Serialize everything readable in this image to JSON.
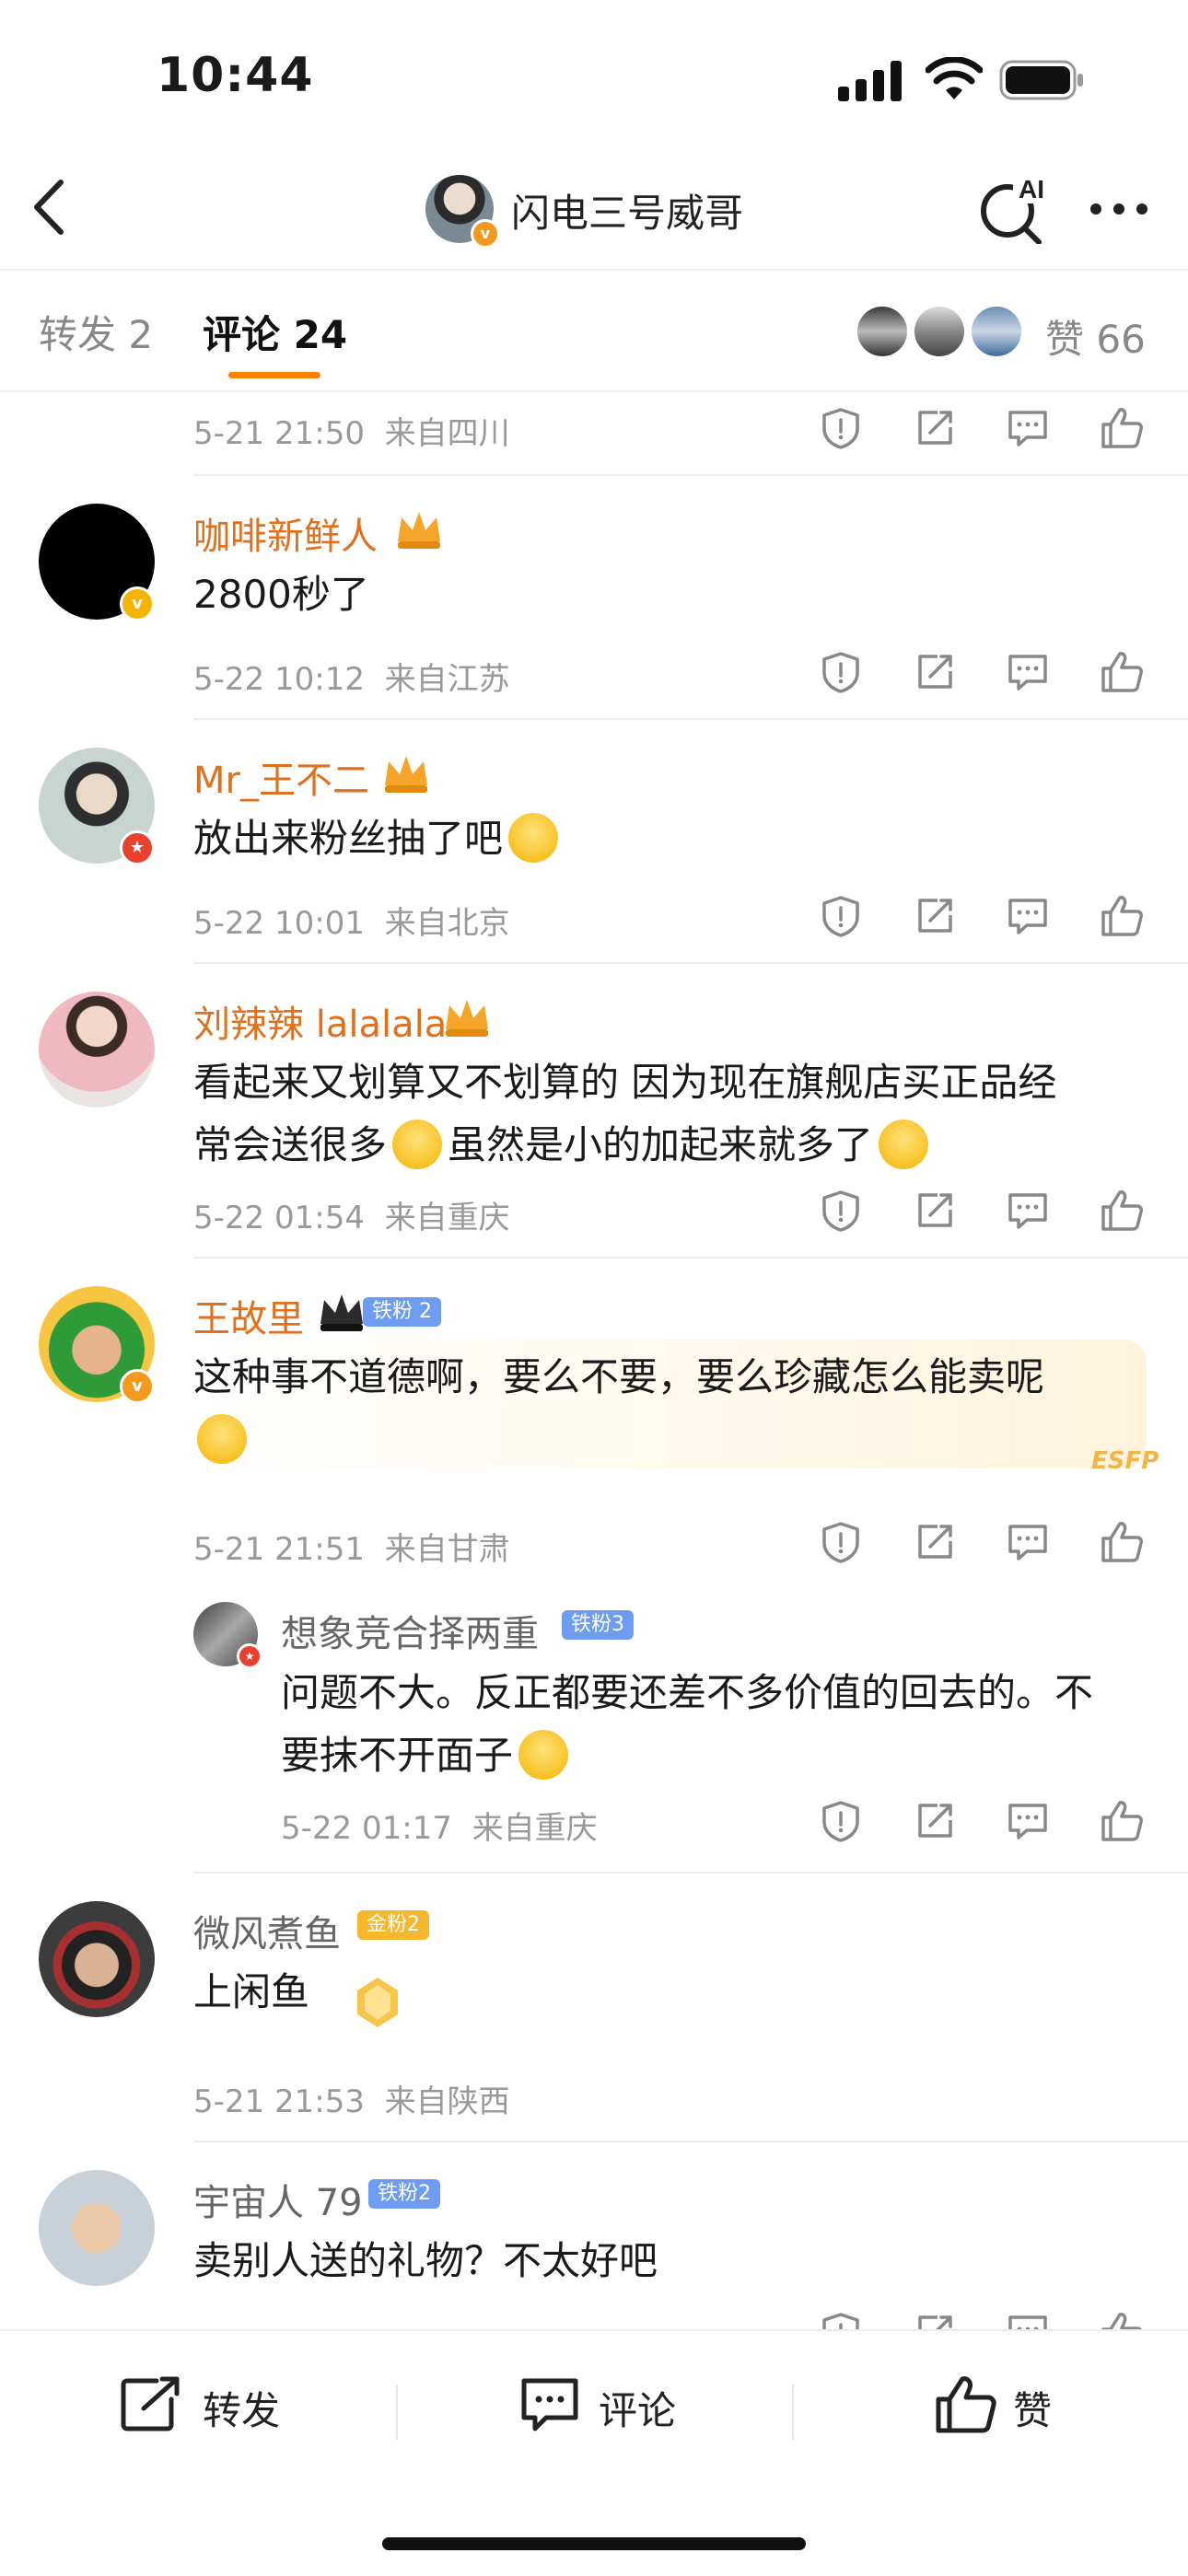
{
  "status_bar": {
    "time": "10:44"
  },
  "nav": {
    "title": "闪电三号威哥",
    "ai_label": "AI"
  },
  "tabs": {
    "repost": "转发 2",
    "comment": "评论 24",
    "likes": "赞 66"
  },
  "top_meta": {
    "date": "5-21 21:50",
    "location": "来自四川"
  },
  "comments": [
    {
      "name": "咖啡新鲜人",
      "text": "2800秒了",
      "date": "5-22 10:12",
      "location": "来自江苏"
    },
    {
      "name": "Mr_王不二",
      "text": "放出来粉丝抽了吧",
      "date": "5-22 10:01",
      "location": "来自北京"
    },
    {
      "name": "刘辣辣 lalalala",
      "text_line1": "看起来又划算又不划算的 因为现在旗舰店买正品经",
      "text_line2a": "常会送很多",
      "text_line2b": "虽然是小的加起来就多了",
      "date": "5-22 01:54",
      "location": "来自重庆"
    },
    {
      "name": "王故里",
      "badge": "铁粉 2",
      "text_line1": "这种事不道德啊，要么不要，要么珍藏怎么能卖呢",
      "tag": "ESFP",
      "date": "5-21 21:51",
      "location": "来自甘肃",
      "reply": {
        "name": "想象竞合择两重",
        "badge": "铁粉3",
        "text_line1": "问题不大。反正都要还差不多价值的回去的。不",
        "text_line2": "要抹不开面子",
        "date": "5-22 01:17",
        "location": "来自重庆"
      }
    },
    {
      "name": "微风煮鱼",
      "badge": "金粉2",
      "text": "上闲鱼",
      "date": "5-21 21:53",
      "location": "来自陕西"
    },
    {
      "name": "宇宙人 79",
      "badge": "铁粉2",
      "text": "卖别人送的礼物？不太好吧"
    }
  ],
  "bottom_bar": {
    "repost": "转发",
    "comment": "评论",
    "like": "赞"
  },
  "colors": {
    "accent": "#ff8200",
    "username": "#e0701d",
    "iron_badge": "#6d9cf0",
    "gold_badge": "#f5b72e"
  }
}
